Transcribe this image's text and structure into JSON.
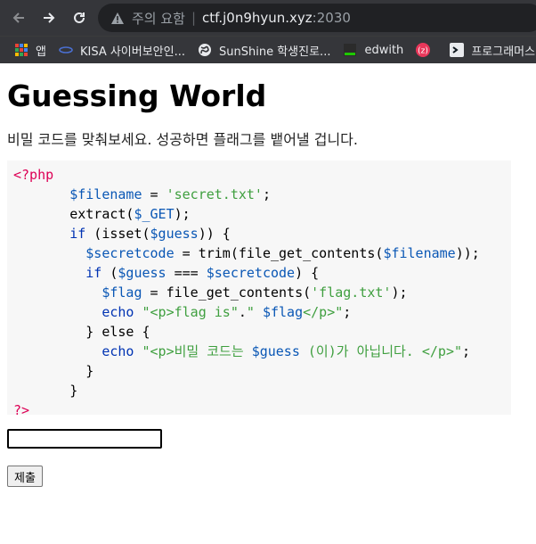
{
  "browser": {
    "security_label": "주의 요함",
    "url_host": "ctf.j0n9hyun.xyz",
    "url_port": ":2030",
    "bookmarks": [
      {
        "label": "앱",
        "icon": "apps-icon"
      },
      {
        "label": "KISA 사이버보안인...",
        "icon": "kisa-icon"
      },
      {
        "label": "SunShine 학생진로...",
        "icon": "globe-icon"
      },
      {
        "label": "edwith",
        "icon": "edwith-icon"
      },
      {
        "label": "",
        "icon": "z-circle-icon"
      },
      {
        "label": "프로그래머스",
        "icon": "programmers-icon"
      }
    ]
  },
  "page": {
    "title": "Guessing World",
    "description": "비밀 코드를 맞춰보세요. 성공하면 플래그를 뱉어낼 겁니다.",
    "code": {
      "open_tag": "<?php",
      "l1_var": "$filename",
      "l1_eq": " = ",
      "l1_str": "'secret.txt'",
      "l1_end": ";",
      "l2_fn": "extract(",
      "l2_var": "$_GET",
      "l2_end": ");",
      "l3_kw": "if",
      "l3_a": " (isset(",
      "l3_var": "$guess",
      "l3_b": ")) {",
      "l4_var": "$secretcode",
      "l4_a": " = trim(file_get_contents(",
      "l4_var2": "$filename",
      "l4_b": "));",
      "l5_kw": "if",
      "l5_a": " (",
      "l5_var": "$guess",
      "l5_b": " === ",
      "l5_var2": "$secretcode",
      "l5_c": ") {",
      "l6_var": "$flag",
      "l6_a": " = file_get_contents(",
      "l6_str": "'flag.txt'",
      "l6_b": ");",
      "l7_kw": "echo",
      "l7_str": " \"<p>flag is\"",
      "l7_a": ".",
      "l7_str2": "\" ",
      "l7_var": "$flag",
      "l7_str3": "</p>\"",
      "l7_b": ";",
      "l8": "} else {",
      "l9_kw": "echo",
      "l9_str": " \"<p>비밀 코드는 ",
      "l9_var": "$guess",
      "l9_str2": " (이)가 아닙니다. </p>\"",
      "l9_b": ";",
      "l10": "}",
      "l11": "}",
      "close_tag": "?>"
    },
    "input_value": "",
    "submit_label": "제출"
  }
}
